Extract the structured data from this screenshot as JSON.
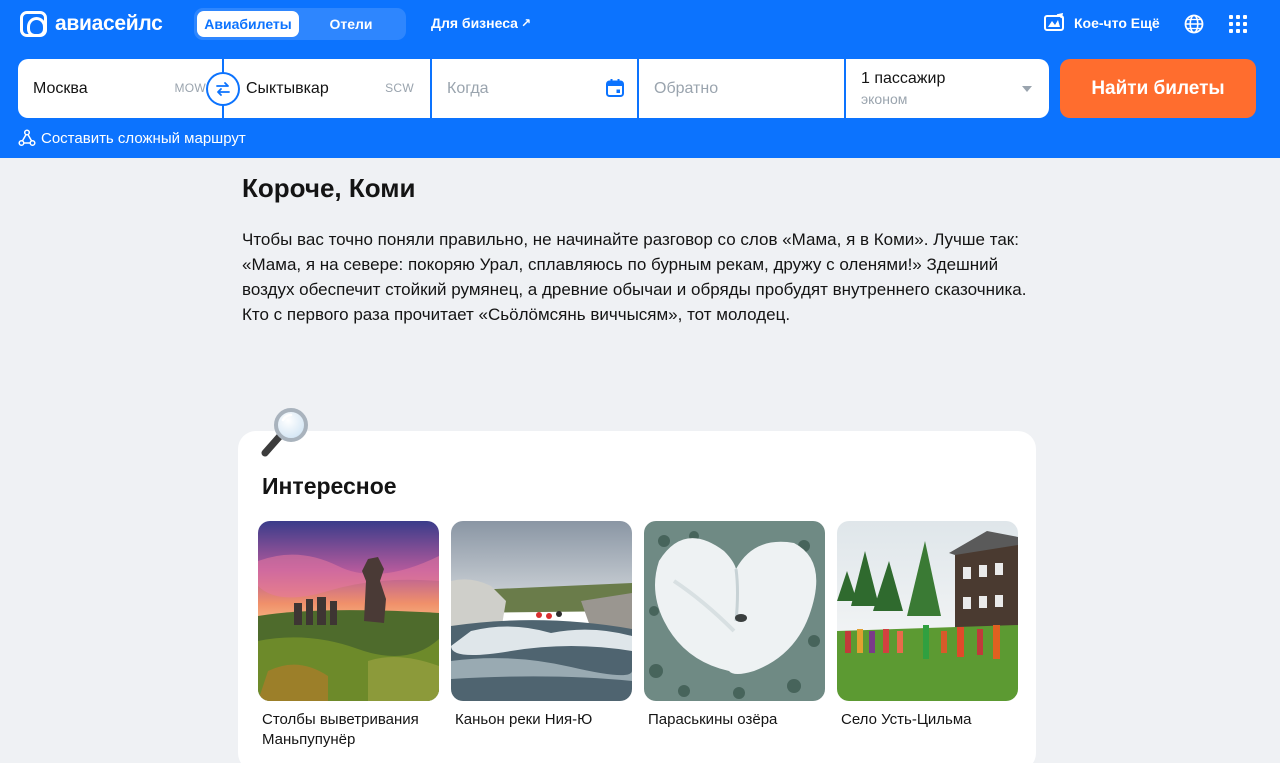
{
  "header": {
    "logo_text": "авиасейлс",
    "tabs": [
      {
        "label": "Авиабилеты",
        "active": true
      },
      {
        "label": "Отели",
        "active": false
      }
    ],
    "business_link": "Для бизнеса",
    "more_label": "Кое-что Ещё",
    "brand_color": "#0c73fe",
    "accent_color": "#ff6d2e"
  },
  "search": {
    "from": {
      "city": "Москва",
      "code": "MOW"
    },
    "to": {
      "city": "Сыктывкар",
      "code": "SCW"
    },
    "when_placeholder": "Когда",
    "back_placeholder": "Обратно",
    "passengers": "1 пассажир",
    "cabin": "эконом",
    "submit_label": "Найти билеты",
    "complex_route_label": "Составить сложный маршрут"
  },
  "main": {
    "title": "Короче, Коми",
    "intro": "Чтобы вас точно поняли правильно, не начинайте разговор со слов «Мама, я в Коми». Лучше так: «Мама, я на севере: покоряю Урал, сплавляюсь по бурным рекам, дружу с оленями!» Здешний воздух обеспечит стойкий румянец, а древние обычаи и обряды пробудят внутреннего сказочника. Кто с первого раза прочитает «Сьӧлӧмсянь виччысям», тот молодец."
  },
  "interesting": {
    "title": "Интересное",
    "items": [
      {
        "caption": "Столбы выветривания Маньпупунёр"
      },
      {
        "caption": "Каньон реки Ния-Ю"
      },
      {
        "caption": "Параськины озёра"
      },
      {
        "caption": "Село Усть-Цильма"
      }
    ]
  }
}
